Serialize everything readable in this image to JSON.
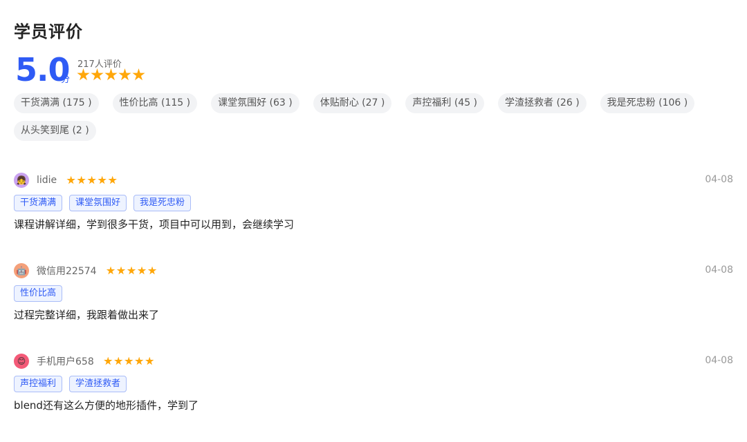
{
  "header": {
    "title": "学员评价",
    "score": "5.0",
    "score_unit": "分",
    "count": "217人评价",
    "rating": 5
  },
  "filters": [
    "干货满满 (175 )",
    "性价比高 (115 )",
    "课堂氛围好 (63 )",
    "体贴耐心 (27 )",
    "声控福利 (45 )",
    "学渣拯救者 (26 )",
    "我是死忠粉 (106 )",
    "从头笑到尾 (2 )"
  ],
  "reviews": [
    {
      "user": "lidie",
      "avatar_icon": "girl-avatar-icon",
      "avatar_glyph": "👧",
      "avatar_color": "#c9a2f0",
      "rating": 5,
      "date": "04-08",
      "tags": [
        "干货满满",
        "课堂氛围好",
        "我是死忠粉"
      ],
      "text": "课程讲解详细，学到很多干货，项目中可以用到，会继续学习"
    },
    {
      "user": "微信用22574",
      "avatar_icon": "robot-avatar-icon",
      "avatar_glyph": "🤖",
      "avatar_color": "#f4a07a",
      "rating": 5,
      "date": "04-08",
      "tags": [
        "性价比高"
      ],
      "text": "过程完整详细，我跟着做出来了"
    },
    {
      "user": "手机用户658",
      "avatar_icon": "smile-avatar-icon",
      "avatar_glyph": "😊",
      "avatar_color": "#f45a78",
      "rating": 5,
      "date": "04-08",
      "tags": [
        "声控福利",
        "学渣拯救者"
      ],
      "text": "blend还有这么方便的地形插件，学到了"
    }
  ],
  "colors": {
    "accent": "#2f5bf5",
    "star": "#ffa70a",
    "tag_bg": "#eef3ff",
    "tag_border": "#a9bcf8",
    "filter_bg": "#f2f3f5"
  }
}
